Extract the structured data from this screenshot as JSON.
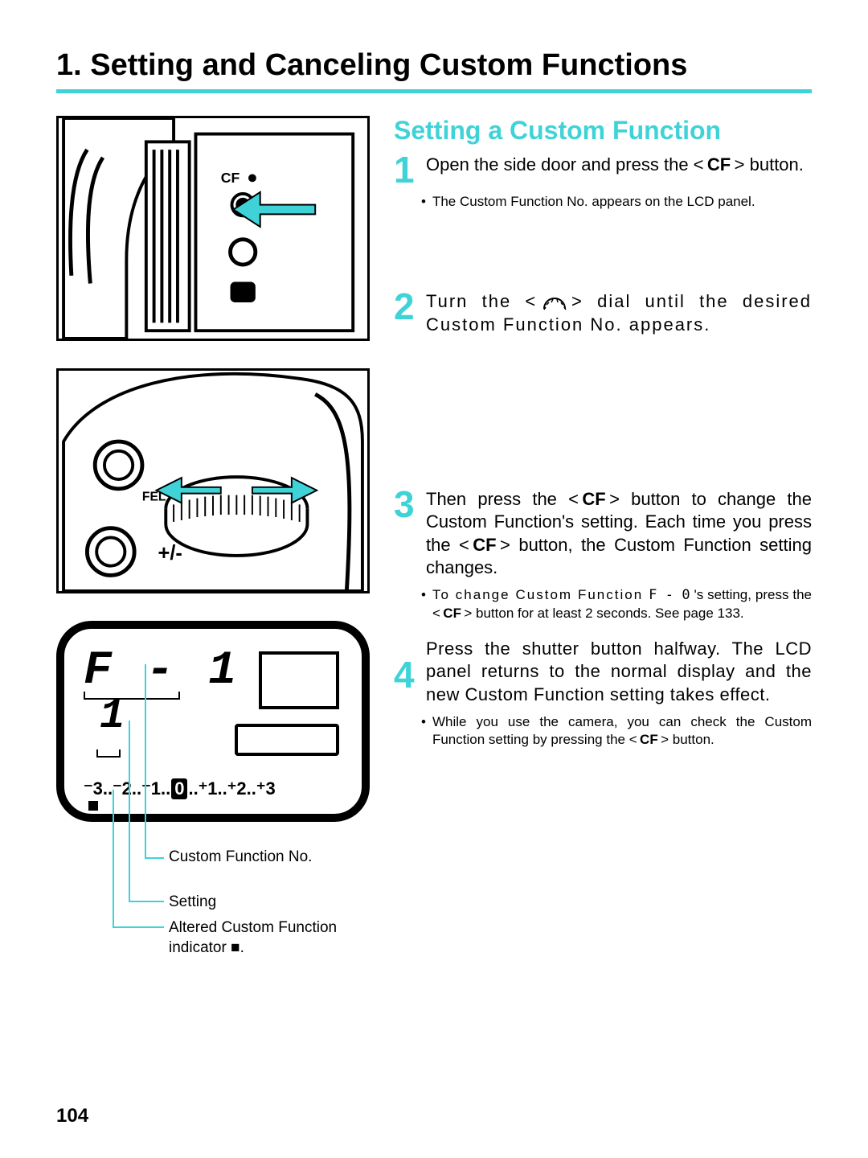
{
  "title": "1. Setting and Canceling Custom Functions",
  "subheading": "Setting a Custom Function",
  "steps": {
    "s1": {
      "num": "1",
      "text_a": "Open the side door and press the < ",
      "cf": "CF",
      "text_b": " > button.",
      "bullet": "The Custom Function No. appears on the LCD panel."
    },
    "s2": {
      "num": "2",
      "text_a": "Turn the < ",
      "text_b": " > dial until the desired Custom Function No. appears."
    },
    "s3": {
      "num": "3",
      "text_a": "Then press the < ",
      "cf1": "CF",
      "text_b": " > button to change the Custom Function's setting. Each time you press the < ",
      "cf2": "CF",
      "text_c": " > button, the Custom Function setting changes.",
      "bullet_a": "To change Custom Function ",
      "bullet_code": "F - 0",
      "bullet_b": " 's setting, press the < ",
      "bullet_cf": "CF",
      "bullet_c": " > button for at least 2 seconds. See page 133."
    },
    "s4": {
      "num": "4",
      "text": "Press the shutter button halfway. The LCD panel returns to the normal display and the new Custom Function setting takes effect.",
      "bullet_a": "While you use the camera, you can check the Custom Function setting by pressing the < ",
      "bullet_cf": "CF",
      "bullet_b": " > button."
    }
  },
  "fig1": {
    "cf_label": "CF"
  },
  "fig2": {
    "fel_label": "FEL"
  },
  "lcd": {
    "top": "F - 1",
    "mid": "1",
    "scale": "⁻3..⁻2..⁻1..",
    "zero": "0",
    "scale2": "..⁺1..⁺2..⁺3"
  },
  "callouts": {
    "c1": "Custom Function No.",
    "c2": "Setting",
    "c3": "Altered Custom Function indicator ■."
  },
  "page_number": "104"
}
